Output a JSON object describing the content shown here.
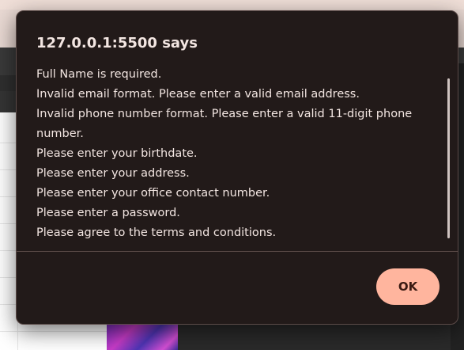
{
  "dialog": {
    "title": "127.0.0.1:5500 says",
    "message_lines": [
      "Full Name is required.",
      "Invalid email format. Please enter a valid email address.",
      "Invalid phone number format. Please enter a valid 11-digit phone number.",
      "Please enter your birthdate.",
      "Please enter your address.",
      "Please enter your office contact number.",
      "Please enter a password.",
      "Please agree to the terms and conditions."
    ],
    "ok_label": "OK"
  },
  "colors": {
    "dialog_background": "#221a19",
    "ok_button": "#ffb59e",
    "text": "#f3e6e2"
  }
}
